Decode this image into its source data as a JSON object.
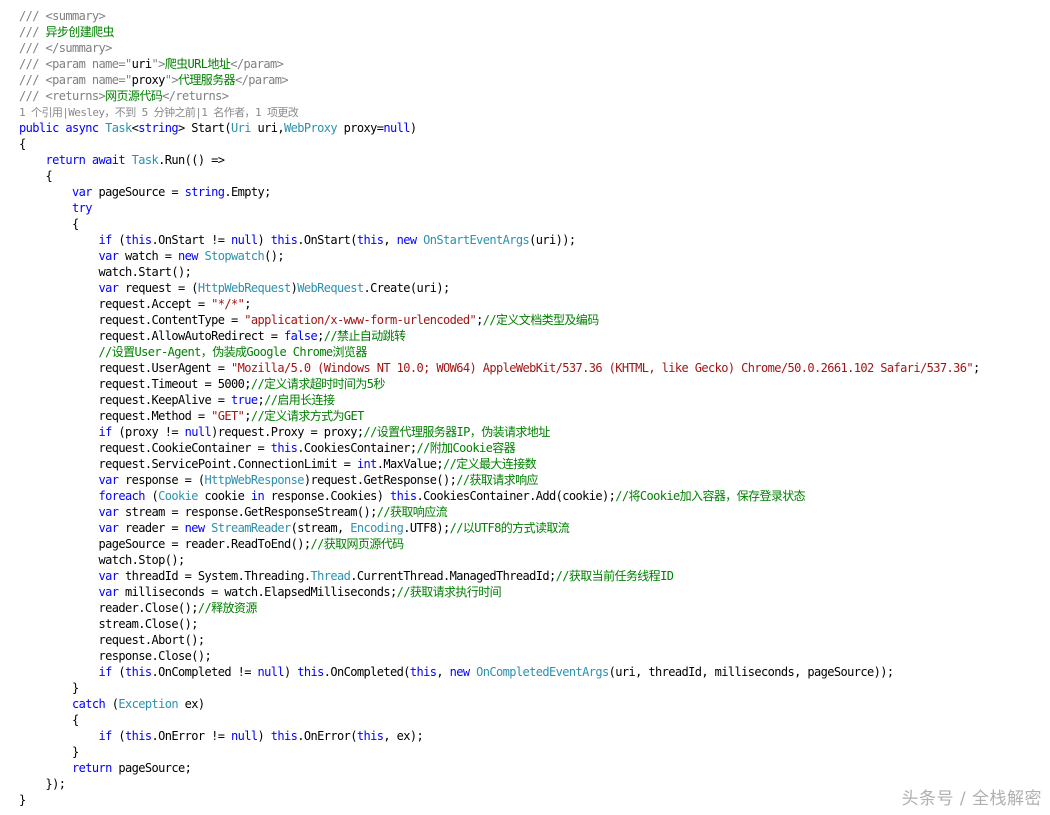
{
  "colors": {
    "keyword": "#0000ff",
    "type": "#2b91af",
    "comment": "#008000",
    "string": "#a31515",
    "doc_gray": "#808080",
    "plain": "#000000",
    "codelens": "#8a8a8a",
    "watermark": "#b0b0b0"
  },
  "code_lines": [
    [
      [
        "g",
        "/// <summary>"
      ]
    ],
    [
      [
        "g",
        "/// "
      ],
      [
        "c",
        "异步创建爬虫"
      ]
    ],
    [
      [
        "g",
        "/// </summary>"
      ]
    ],
    [
      [
        "g",
        "/// <param name=\""
      ],
      [
        "t",
        "uri"
      ],
      [
        "g",
        "\">"
      ],
      [
        "c",
        "爬虫URL地址"
      ],
      [
        "g",
        "</param>"
      ]
    ],
    [
      [
        "g",
        "/// <param name=\""
      ],
      [
        "t",
        "proxy"
      ],
      [
        "g",
        "\">"
      ],
      [
        "c",
        "代理服务器"
      ],
      [
        "g",
        "</param>"
      ]
    ],
    [
      [
        "g",
        "/// <returns>"
      ],
      [
        "c",
        "网页源代码"
      ],
      [
        "g",
        "</returns>"
      ]
    ],
    [
      [
        "l",
        "1 个引用|Wesley，不到 5 分钟之前|1 名作者，1 项更改"
      ]
    ],
    [
      [
        "k",
        "public async "
      ],
      [
        "y",
        "Task"
      ],
      [
        "t",
        "<"
      ],
      [
        "k",
        "string"
      ],
      [
        "t",
        "> Start("
      ],
      [
        "y",
        "Uri"
      ],
      [
        "t",
        " uri,"
      ],
      [
        "y",
        "WebProxy"
      ],
      [
        "t",
        " proxy="
      ],
      [
        "k",
        "null"
      ],
      [
        "t",
        ")"
      ]
    ],
    [
      [
        "t",
        "{"
      ]
    ],
    [
      [
        "t",
        "    "
      ],
      [
        "k",
        "return await "
      ],
      [
        "y",
        "Task"
      ],
      [
        "t",
        ".Run(() =>"
      ]
    ],
    [
      [
        "t",
        "    {"
      ]
    ],
    [
      [
        "t",
        "        "
      ],
      [
        "k",
        "var"
      ],
      [
        "t",
        " pageSource = "
      ],
      [
        "k",
        "string"
      ],
      [
        "t",
        ".Empty;"
      ]
    ],
    [
      [
        "t",
        "        "
      ],
      [
        "k",
        "try"
      ]
    ],
    [
      [
        "t",
        "        {"
      ]
    ],
    [
      [
        "t",
        "            "
      ],
      [
        "k",
        "if"
      ],
      [
        "t",
        " ("
      ],
      [
        "k",
        "this"
      ],
      [
        "t",
        ".OnStart != "
      ],
      [
        "k",
        "null"
      ],
      [
        "t",
        ") "
      ],
      [
        "k",
        "this"
      ],
      [
        "t",
        ".OnStart("
      ],
      [
        "k",
        "this"
      ],
      [
        "t",
        ", "
      ],
      [
        "k",
        "new "
      ],
      [
        "y",
        "OnStartEventArgs"
      ],
      [
        "t",
        "(uri));"
      ]
    ],
    [
      [
        "t",
        "            "
      ],
      [
        "k",
        "var"
      ],
      [
        "t",
        " watch = "
      ],
      [
        "k",
        "new "
      ],
      [
        "y",
        "Stopwatch"
      ],
      [
        "t",
        "();"
      ]
    ],
    [
      [
        "t",
        "            watch.Start();"
      ]
    ],
    [
      [
        "t",
        "            "
      ],
      [
        "k",
        "var"
      ],
      [
        "t",
        " request = ("
      ],
      [
        "y",
        "HttpWebRequest"
      ],
      [
        "t",
        ")"
      ],
      [
        "y",
        "WebRequest"
      ],
      [
        "t",
        ".Create(uri);"
      ]
    ],
    [
      [
        "t",
        "            request.Accept = "
      ],
      [
        "s",
        "\"*/*\""
      ],
      [
        "t",
        ";"
      ]
    ],
    [
      [
        "t",
        "            request.ContentType = "
      ],
      [
        "s",
        "\"application/x-www-form-urlencoded\""
      ],
      [
        "t",
        ";"
      ],
      [
        "c",
        "//定义文档类型及编码"
      ]
    ],
    [
      [
        "t",
        "            request.AllowAutoRedirect = "
      ],
      [
        "k",
        "false"
      ],
      [
        "t",
        ";"
      ],
      [
        "c",
        "//禁止自动跳转"
      ]
    ],
    [
      [
        "t",
        "            "
      ],
      [
        "c",
        "//设置User-Agent，伪装成Google Chrome浏览器"
      ]
    ],
    [
      [
        "t",
        "            request.UserAgent = "
      ],
      [
        "s",
        "\"Mozilla/5.0 (Windows NT 10.0; WOW64) AppleWebKit/537.36 (KHTML, like Gecko) Chrome/50.0.2661.102 Safari/537.36\""
      ],
      [
        "t",
        ";"
      ]
    ],
    [
      [
        "t",
        "            request.Timeout = 5000;"
      ],
      [
        "c",
        "//定义请求超时时间为5秒"
      ]
    ],
    [
      [
        "t",
        "            request.KeepAlive = "
      ],
      [
        "k",
        "true"
      ],
      [
        "t",
        ";"
      ],
      [
        "c",
        "//启用长连接"
      ]
    ],
    [
      [
        "t",
        "            request.Method = "
      ],
      [
        "s",
        "\"GET\""
      ],
      [
        "t",
        ";"
      ],
      [
        "c",
        "//定义请求方式为GET"
      ]
    ],
    [
      [
        "t",
        "            "
      ],
      [
        "k",
        "if"
      ],
      [
        "t",
        " (proxy != "
      ],
      [
        "k",
        "null"
      ],
      [
        "t",
        ")request.Proxy = proxy;"
      ],
      [
        "c",
        "//设置代理服务器IP，伪装请求地址"
      ]
    ],
    [
      [
        "t",
        "            request.CookieContainer = "
      ],
      [
        "k",
        "this"
      ],
      [
        "t",
        ".CookiesContainer;"
      ],
      [
        "c",
        "//附加Cookie容器"
      ]
    ],
    [
      [
        "t",
        "            request.ServicePoint.ConnectionLimit = "
      ],
      [
        "k",
        "int"
      ],
      [
        "t",
        ".MaxValue;"
      ],
      [
        "c",
        "//定义最大连接数"
      ]
    ],
    [
      [
        "t",
        "            "
      ],
      [
        "k",
        "var"
      ],
      [
        "t",
        " response = ("
      ],
      [
        "y",
        "HttpWebResponse"
      ],
      [
        "t",
        ")request.GetResponse();"
      ],
      [
        "c",
        "//获取请求响应"
      ]
    ],
    [
      [
        "t",
        "            "
      ],
      [
        "k",
        "foreach"
      ],
      [
        "t",
        " ("
      ],
      [
        "y",
        "Cookie"
      ],
      [
        "t",
        " cookie "
      ],
      [
        "k",
        "in"
      ],
      [
        "t",
        " response.Cookies) "
      ],
      [
        "k",
        "this"
      ],
      [
        "t",
        ".CookiesContainer.Add(cookie);"
      ],
      [
        "c",
        "//将Cookie加入容器，保存登录状态"
      ]
    ],
    [
      [
        "t",
        "            "
      ],
      [
        "k",
        "var"
      ],
      [
        "t",
        " stream = response.GetResponseStream();"
      ],
      [
        "c",
        "//获取响应流"
      ]
    ],
    [
      [
        "t",
        "            "
      ],
      [
        "k",
        "var"
      ],
      [
        "t",
        " reader = "
      ],
      [
        "k",
        "new "
      ],
      [
        "y",
        "StreamReader"
      ],
      [
        "t",
        "(stream, "
      ],
      [
        "y",
        "Encoding"
      ],
      [
        "t",
        ".UTF8);"
      ],
      [
        "c",
        "//以UTF8的方式读取流"
      ]
    ],
    [
      [
        "t",
        "            pageSource = reader.ReadToEnd();"
      ],
      [
        "c",
        "//获取网页源代码"
      ]
    ],
    [
      [
        "t",
        "            watch.Stop();"
      ]
    ],
    [
      [
        "t",
        "            "
      ],
      [
        "k",
        "var"
      ],
      [
        "t",
        " threadId = System.Threading."
      ],
      [
        "y",
        "Thread"
      ],
      [
        "t",
        ".CurrentThread.ManagedThreadId;"
      ],
      [
        "c",
        "//获取当前任务线程ID"
      ]
    ],
    [
      [
        "t",
        "            "
      ],
      [
        "k",
        "var"
      ],
      [
        "t",
        " milliseconds = watch.ElapsedMilliseconds;"
      ],
      [
        "c",
        "//获取请求执行时间"
      ]
    ],
    [
      [
        "t",
        "            reader.Close();"
      ],
      [
        "c",
        "//释放资源"
      ]
    ],
    [
      [
        "t",
        "            stream.Close();"
      ]
    ],
    [
      [
        "t",
        "            request.Abort();"
      ]
    ],
    [
      [
        "t",
        "            response.Close();"
      ]
    ],
    [
      [
        "t",
        "            "
      ],
      [
        "k",
        "if"
      ],
      [
        "t",
        " ("
      ],
      [
        "k",
        "this"
      ],
      [
        "t",
        ".OnCompleted != "
      ],
      [
        "k",
        "null"
      ],
      [
        "t",
        ") "
      ],
      [
        "k",
        "this"
      ],
      [
        "t",
        ".OnCompleted("
      ],
      [
        "k",
        "this"
      ],
      [
        "t",
        ", "
      ],
      [
        "k",
        "new "
      ],
      [
        "y",
        "OnCompletedEventArgs"
      ],
      [
        "t",
        "(uri, threadId, milliseconds, pageSource));"
      ]
    ],
    [
      [
        "t",
        "        }"
      ]
    ],
    [
      [
        "t",
        "        "
      ],
      [
        "k",
        "catch"
      ],
      [
        "t",
        " ("
      ],
      [
        "y",
        "Exception"
      ],
      [
        "t",
        " ex)"
      ]
    ],
    [
      [
        "t",
        "        {"
      ]
    ],
    [
      [
        "t",
        "            "
      ],
      [
        "k",
        "if"
      ],
      [
        "t",
        " ("
      ],
      [
        "k",
        "this"
      ],
      [
        "t",
        ".OnError != "
      ],
      [
        "k",
        "null"
      ],
      [
        "t",
        ") "
      ],
      [
        "k",
        "this"
      ],
      [
        "t",
        ".OnError("
      ],
      [
        "k",
        "this"
      ],
      [
        "t",
        ", ex);"
      ]
    ],
    [
      [
        "t",
        "        }"
      ]
    ],
    [
      [
        "t",
        "        "
      ],
      [
        "k",
        "return"
      ],
      [
        "t",
        " pageSource;"
      ]
    ],
    [
      [
        "t",
        "    });"
      ]
    ],
    [
      [
        "t",
        "}"
      ]
    ]
  ],
  "watermark": "头条号 / 全栈解密"
}
